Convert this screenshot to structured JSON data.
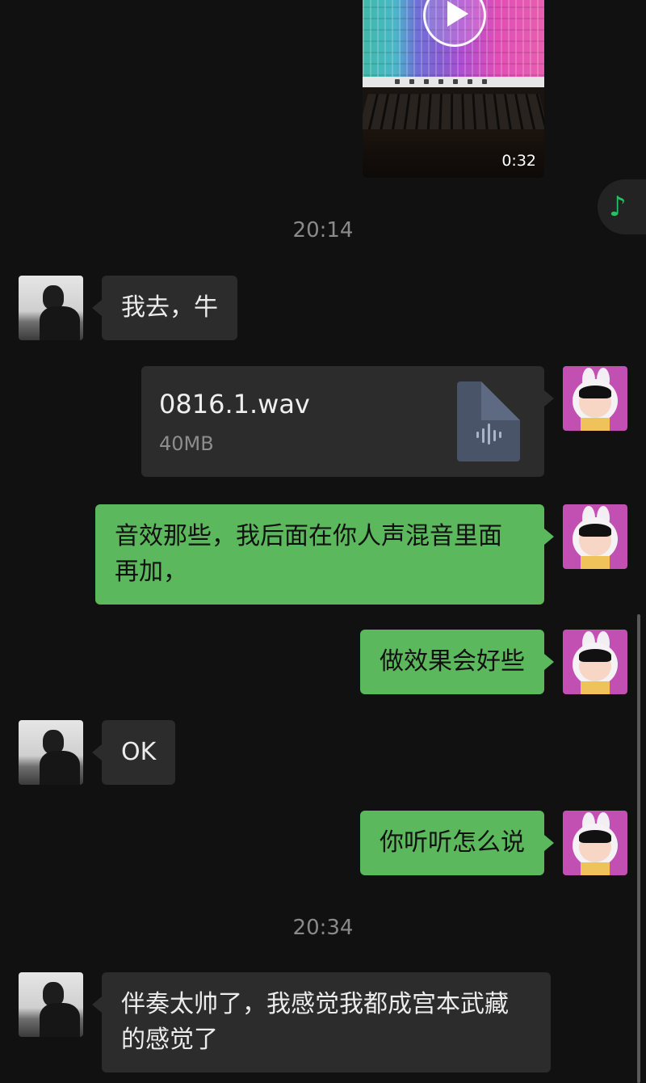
{
  "video": {
    "duration": "0:32"
  },
  "music_button": {
    "icon": "music-note-icon",
    "glyph": "♪"
  },
  "times": [
    "20:14",
    "20:34"
  ],
  "messages": [
    {
      "side": "left",
      "text": "我去，牛"
    },
    {
      "side": "right",
      "type": "file",
      "file_name": "0816.1.wav",
      "file_size": "40MB",
      "icon": "audio-file-icon"
    },
    {
      "side": "right",
      "text": "音效那些，我后面在你人声混音里面再加，"
    },
    {
      "side": "right",
      "text": "做效果会好些"
    },
    {
      "side": "left",
      "text": "OK"
    },
    {
      "side": "right",
      "text": "你听听怎么说"
    },
    {
      "side": "left",
      "text": "伴奏太帅了，我感觉我都成宫本武藏的感觉了"
    }
  ],
  "colors": {
    "background": "#111111",
    "bubble_in": "#2c2c2c",
    "bubble_out": "#5cb85c",
    "accent": "#23c35f"
  }
}
